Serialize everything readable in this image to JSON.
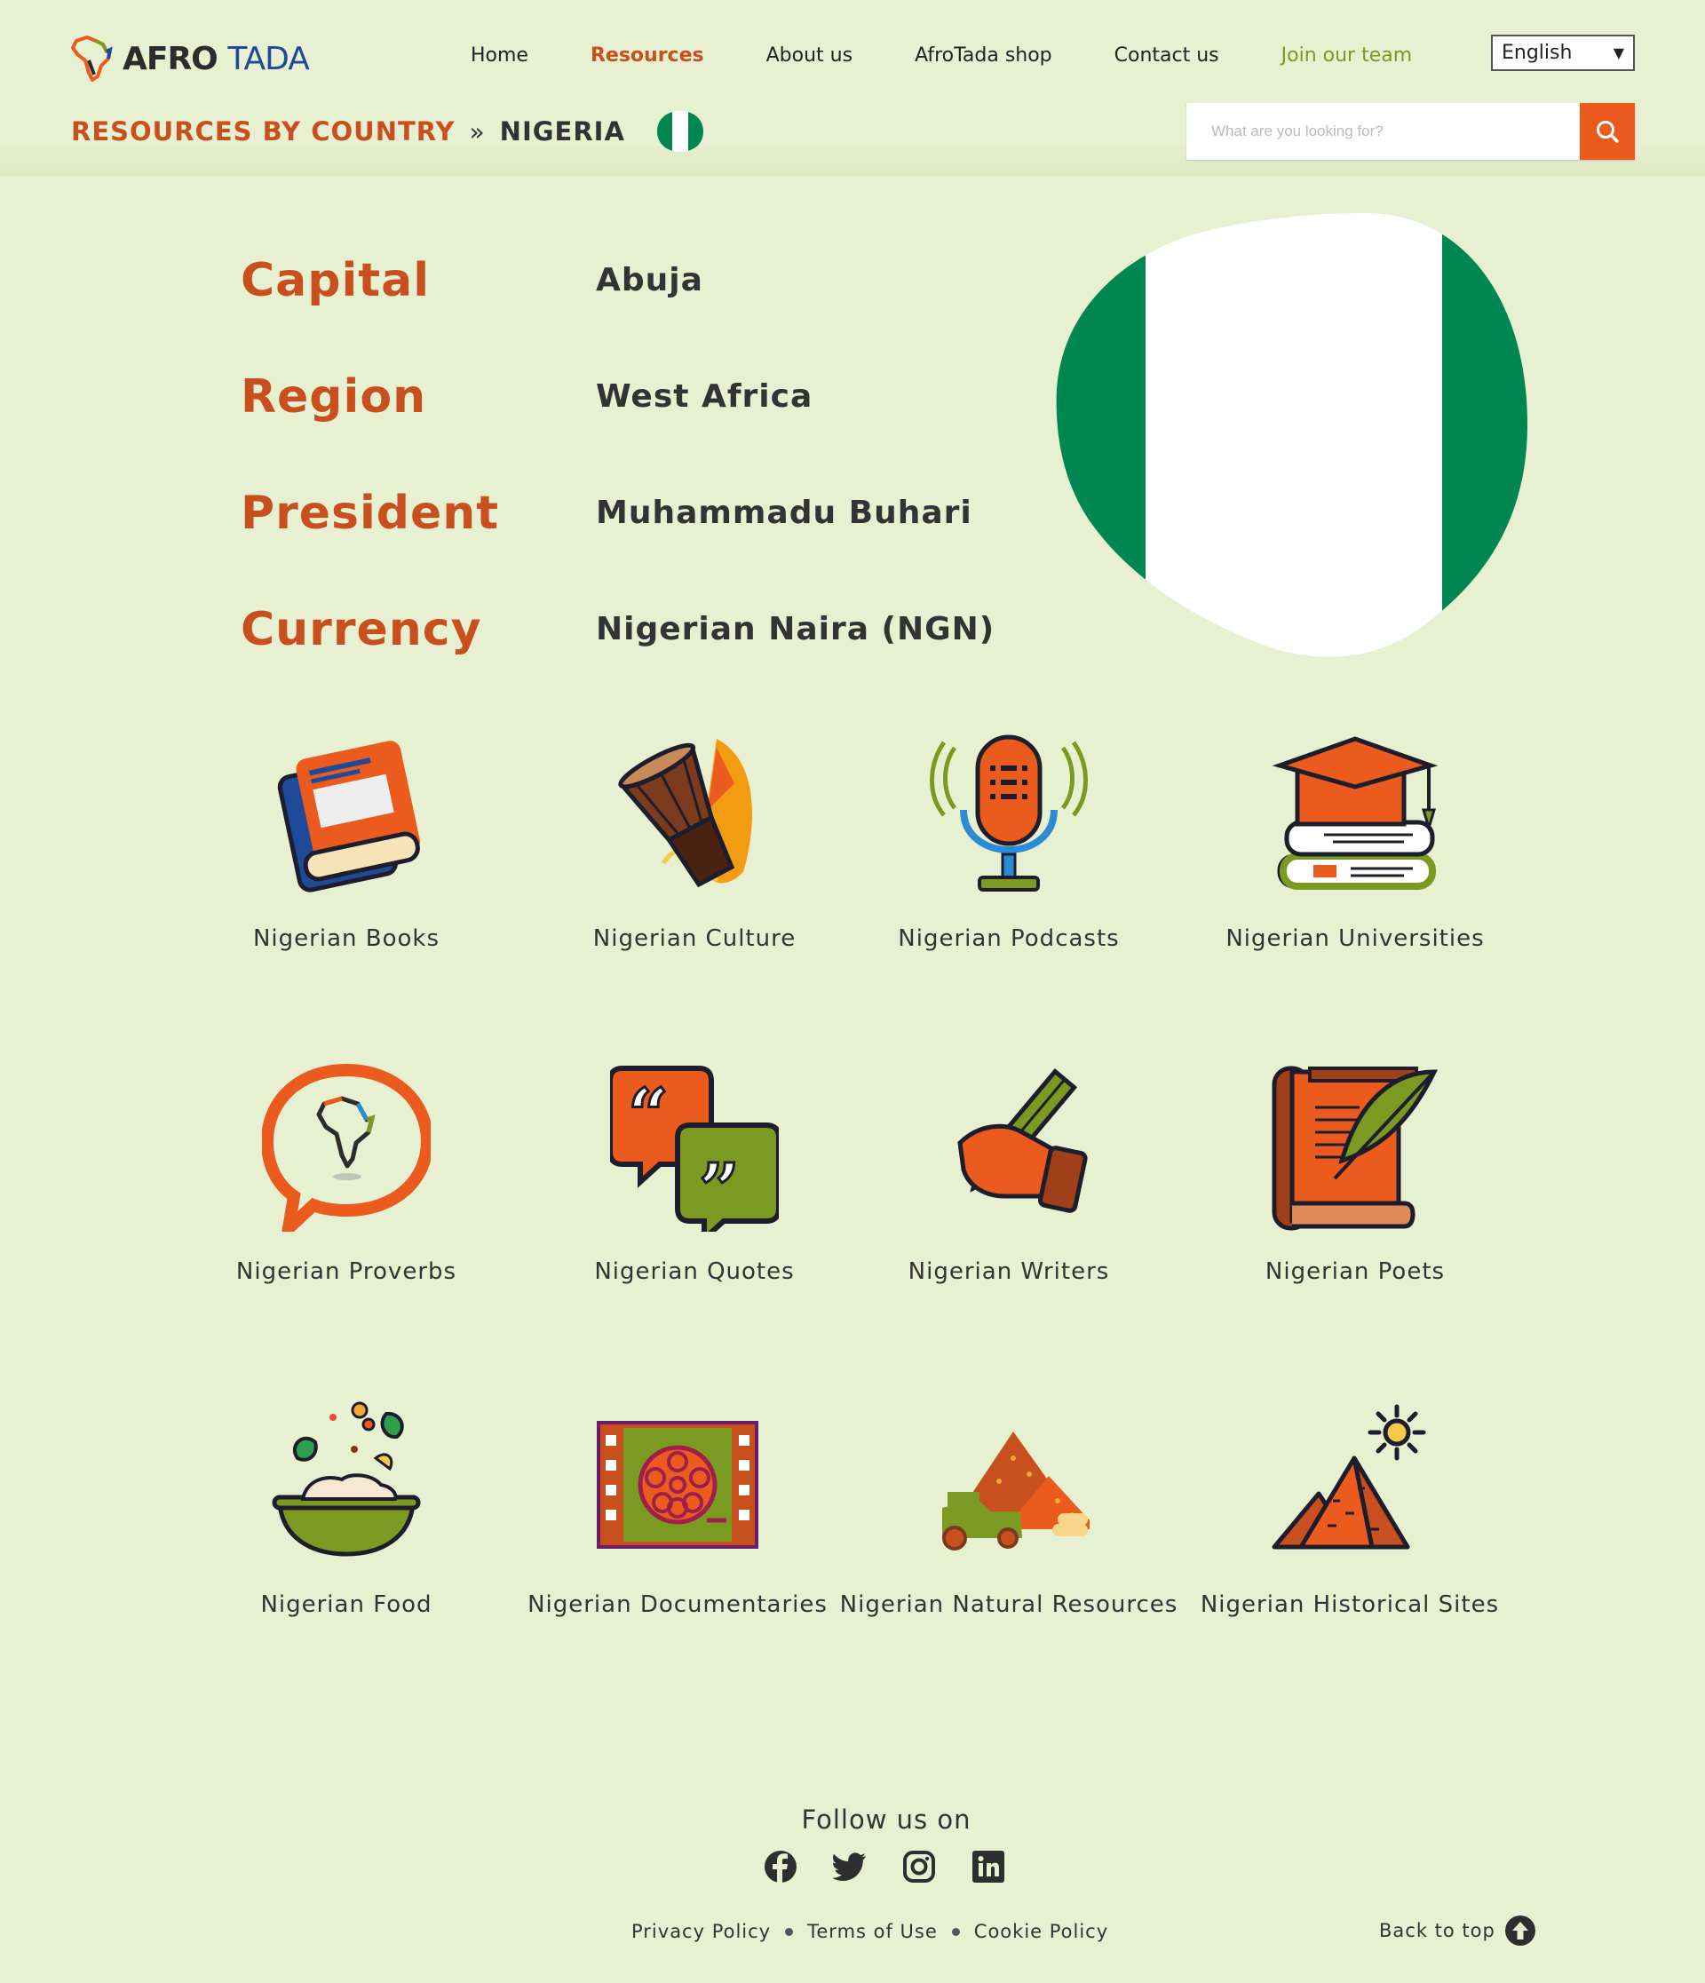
{
  "header": {
    "logo": {
      "part1": "AFRO",
      "part2": "TADA"
    },
    "nav": [
      {
        "label": "Home",
        "state": "normal"
      },
      {
        "label": "Resources",
        "state": "active"
      },
      {
        "label": "About us",
        "state": "normal"
      },
      {
        "label": "AfroTada shop",
        "state": "normal"
      },
      {
        "label": "Contact us",
        "state": "normal"
      },
      {
        "label": "Join our team",
        "state": "highlight"
      }
    ],
    "language": {
      "selected": "English"
    }
  },
  "breadcrumb": {
    "root": "RESOURCES BY COUNTRY",
    "separator": "»",
    "current": "NIGERIA"
  },
  "search": {
    "placeholder": "What are you looking for?"
  },
  "facts": [
    {
      "label": "Capital",
      "value": "Abuja"
    },
    {
      "label": "Region",
      "value": "West Africa"
    },
    {
      "label": "President",
      "value": "Muhammadu Buhari"
    },
    {
      "label": "Currency",
      "value": "Nigerian Naira (NGN)"
    }
  ],
  "resources": [
    {
      "label": "Nigerian Books",
      "icon": "books-icon"
    },
    {
      "label": "Nigerian Culture",
      "icon": "drum-icon"
    },
    {
      "label": "Nigerian Podcasts",
      "icon": "microphone-icon"
    },
    {
      "label": "Nigerian Universities",
      "icon": "graduation-cap-icon"
    },
    {
      "label": "Nigerian Proverbs",
      "icon": "speech-bubble-africa-icon"
    },
    {
      "label": "Nigerian Quotes",
      "icon": "quotes-icon"
    },
    {
      "label": "Nigerian Writers",
      "icon": "hand-pencil-icon"
    },
    {
      "label": "Nigerian Poets",
      "icon": "scroll-quill-icon"
    },
    {
      "label": "Nigerian Food",
      "icon": "food-bowl-icon"
    },
    {
      "label": "Nigerian Documentaries",
      "icon": "film-reel-icon"
    },
    {
      "label": "Nigerian Natural Resources",
      "icon": "mining-icon"
    },
    {
      "label": "Nigerian Historical Sites",
      "icon": "pyramids-icon"
    }
  ],
  "footer": {
    "follow": "Follow us on",
    "socials": [
      "facebook-icon",
      "twitter-icon",
      "instagram-icon",
      "linkedin-icon"
    ],
    "legal": [
      "Privacy Policy",
      "Terms of Use",
      "Cookie Policy"
    ],
    "back_to_top": "Back to top"
  },
  "colors": {
    "background": "#e8f0d2",
    "accent_orange": "#c8501e",
    "search_button": "#ec5b1e",
    "nav_green": "#7a9a22",
    "flag_green": "#008751"
  }
}
